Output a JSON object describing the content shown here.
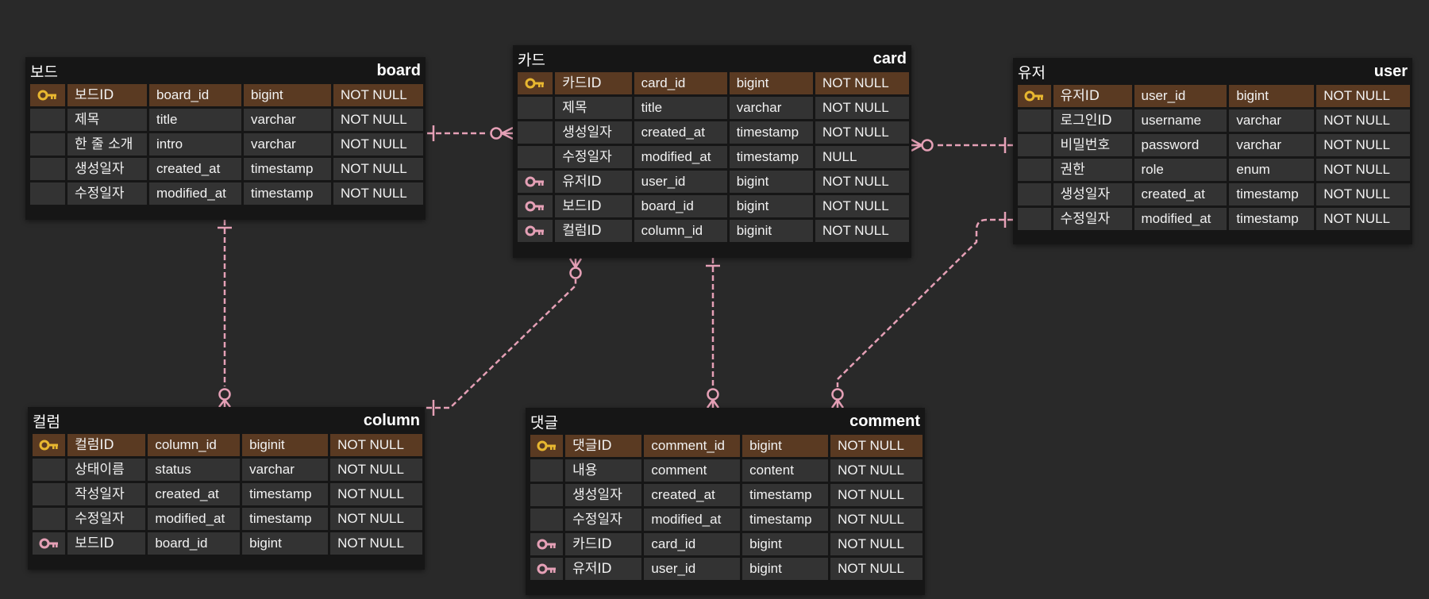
{
  "colors": {
    "background": "#292929",
    "table": "#161616",
    "cell": "#333333",
    "pk_row": "#5a3a22",
    "pk_key": "#e8b730",
    "fk_key": "#e5a0b6",
    "relation": "#e5a0b6"
  },
  "tables": {
    "board": {
      "title_ko": "보드",
      "title_en": "board",
      "rows": [
        {
          "key": "primary-key-icon",
          "ko": "보드ID",
          "name": "board_id",
          "type": "bigint",
          "constraint": "NOT NULL"
        },
        {
          "key": "",
          "ko": "제목",
          "name": "title",
          "type": "varchar",
          "constraint": "NOT NULL"
        },
        {
          "key": "",
          "ko": "한 줄 소개",
          "name": "intro",
          "type": "varchar",
          "constraint": "NOT NULL"
        },
        {
          "key": "",
          "ko": "생성일자",
          "name": "created_at",
          "type": "timestamp",
          "constraint": "NOT NULL"
        },
        {
          "key": "",
          "ko": "수정일자",
          "name": "modified_at",
          "type": "timestamp",
          "constraint": "NOT NULL"
        }
      ]
    },
    "card": {
      "title_ko": "카드",
      "title_en": "card",
      "rows": [
        {
          "key": "primary-key-icon",
          "ko": "카드ID",
          "name": "card_id",
          "type": "bigint",
          "constraint": "NOT NULL"
        },
        {
          "key": "",
          "ko": "제목",
          "name": "title",
          "type": "varchar",
          "constraint": "NOT NULL"
        },
        {
          "key": "",
          "ko": "생성일자",
          "name": "created_at",
          "type": "timestamp",
          "constraint": "NOT NULL"
        },
        {
          "key": "",
          "ko": "수정일자",
          "name": "modified_at",
          "type": "timestamp",
          "constraint": "NULL"
        },
        {
          "key": "foreign-key-icon",
          "ko": "유저ID",
          "name": "user_id",
          "type": "bigint",
          "constraint": "NOT NULL"
        },
        {
          "key": "foreign-key-icon",
          "ko": "보드ID",
          "name": "board_id",
          "type": "bigint",
          "constraint": "NOT NULL"
        },
        {
          "key": "foreign-key-icon",
          "ko": "컬럼ID",
          "name": "column_id",
          "type": "biginit",
          "constraint": "NOT NULL"
        }
      ]
    },
    "user": {
      "title_ko": "유저",
      "title_en": "user",
      "rows": [
        {
          "key": "primary-key-icon",
          "ko": "유저ID",
          "name": "user_id",
          "type": "bigint",
          "constraint": "NOT NULL"
        },
        {
          "key": "",
          "ko": "로그인ID",
          "name": "username",
          "type": "varchar",
          "constraint": "NOT NULL"
        },
        {
          "key": "",
          "ko": "비밀번호",
          "name": "password",
          "type": "varchar",
          "constraint": "NOT NULL"
        },
        {
          "key": "",
          "ko": "권한",
          "name": "role",
          "type": "enum",
          "constraint": "NOT NULL"
        },
        {
          "key": "",
          "ko": "생성일자",
          "name": "created_at",
          "type": "timestamp",
          "constraint": "NOT NULL"
        },
        {
          "key": "",
          "ko": "수정일자",
          "name": "modified_at",
          "type": "timestamp",
          "constraint": "NOT NULL"
        }
      ]
    },
    "column": {
      "title_ko": "컬럼",
      "title_en": "column",
      "rows": [
        {
          "key": "primary-key-icon",
          "ko": "컬럼ID",
          "name": "column_id",
          "type": "biginit",
          "constraint": "NOT NULL"
        },
        {
          "key": "",
          "ko": "상태이름",
          "name": "status",
          "type": "varchar",
          "constraint": "NOT NULL"
        },
        {
          "key": "",
          "ko": "작성일자",
          "name": "created_at",
          "type": "timestamp",
          "constraint": "NOT NULL"
        },
        {
          "key": "",
          "ko": "수정일자",
          "name": "modified_at",
          "type": "timestamp",
          "constraint": "NOT NULL"
        },
        {
          "key": "foreign-key-icon",
          "ko": "보드ID",
          "name": "board_id",
          "type": "bigint",
          "constraint": "NOT NULL"
        }
      ]
    },
    "comment": {
      "title_ko": "댓글",
      "title_en": "comment",
      "rows": [
        {
          "key": "primary-key-icon",
          "ko": "댓글ID",
          "name": "comment_id",
          "type": "bigint",
          "constraint": "NOT NULL"
        },
        {
          "key": "",
          "ko": "내용",
          "name": "comment",
          "type": "content",
          "constraint": "NOT NULL"
        },
        {
          "key": "",
          "ko": "생성일자",
          "name": "created_at",
          "type": "timestamp",
          "constraint": "NOT NULL"
        },
        {
          "key": "",
          "ko": "수정일자",
          "name": "modified_at",
          "type": "timestamp",
          "constraint": "NOT NULL"
        },
        {
          "key": "foreign-key-icon",
          "ko": "카드ID",
          "name": "card_id",
          "type": "bigint",
          "constraint": "NOT NULL"
        },
        {
          "key": "foreign-key-icon",
          "ko": "유저ID",
          "name": "user_id",
          "type": "bigint",
          "constraint": "NOT NULL"
        }
      ]
    }
  },
  "relationships": [
    {
      "from": "board",
      "to": "card",
      "from_end": "one",
      "to_end": "zero-or-many"
    },
    {
      "from": "user",
      "to": "card",
      "from_end": "one",
      "to_end": "zero-or-many"
    },
    {
      "from": "board",
      "to": "column",
      "from_end": "one",
      "to_end": "zero-or-many"
    },
    {
      "from": "column",
      "to": "card",
      "from_end": "one",
      "to_end": "zero-or-many"
    },
    {
      "from": "card",
      "to": "comment",
      "from_end": "one",
      "to_end": "zero-or-many"
    },
    {
      "from": "user",
      "to": "comment",
      "from_end": "one",
      "to_end": "zero-or-many"
    }
  ]
}
